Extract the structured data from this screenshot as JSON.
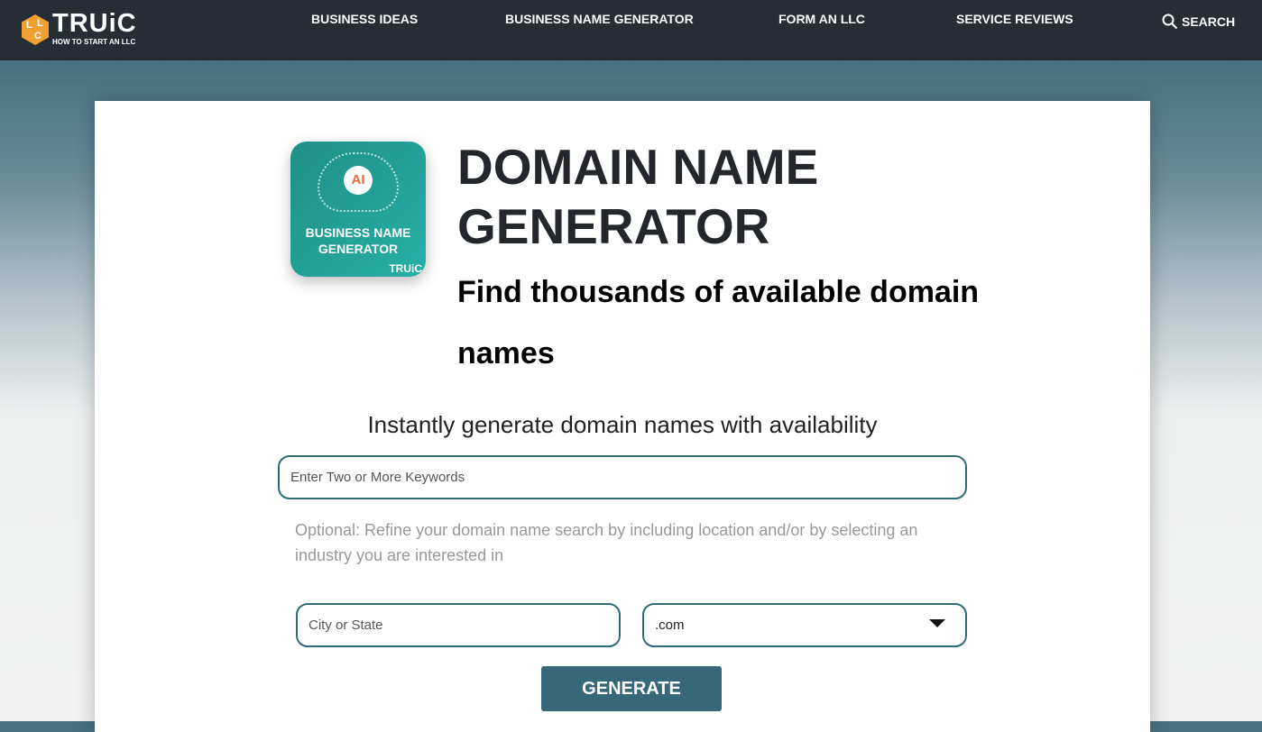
{
  "nav": {
    "brand": "TRUiC",
    "tagline": "HOW TO START AN LLC",
    "cube_letters": [
      "L",
      "L",
      "C"
    ],
    "items": [
      "BUSINESS IDEAS",
      "BUSINESS NAME GENERATOR",
      "FORM AN LLC",
      "SERVICE REVIEWS"
    ],
    "search_label": "SEARCH",
    "search_icon": "magnifier-icon"
  },
  "hero": {
    "app_icon": {
      "badge": "AI",
      "title": "BUSINESS NAME GENERATOR",
      "brand": "TRUiC"
    },
    "title": "DOMAIN NAME GENERATOR",
    "subtitle": "Find thousands of available domain names"
  },
  "form": {
    "intro": "Instantly generate domain names with availability",
    "keywords_placeholder": "Enter Two or More Keywords",
    "optional_text": "Optional: Refine your domain name search by including location and/or by selecting an industry you are interested in",
    "location_placeholder": "City or State",
    "tld_selected": ".com",
    "generate_label": "GENERATE"
  },
  "colors": {
    "nav": "#262d35",
    "accent": "#2e6b78",
    "button": "#36687a",
    "icon_teal": "#27b0a6",
    "logo_orange": "#f0a030"
  }
}
